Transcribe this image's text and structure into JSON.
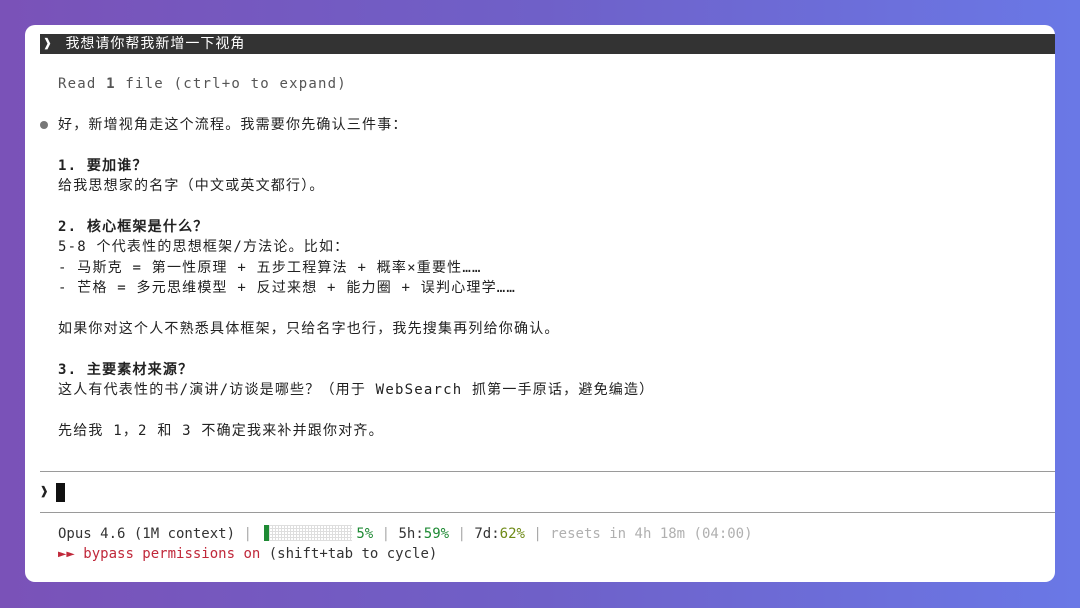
{
  "prompt": {
    "chevron": "❱",
    "text": "我想请你帮我新增一下视角"
  },
  "tool_line": {
    "prefix": "Read ",
    "count": "1",
    "suffix": " file (ctrl+o to expand)"
  },
  "response": {
    "intro": "好，新增视角走这个流程。我需要你先确认三件事：",
    "q1_title": "1. 要加谁？",
    "q1_body": "给我思想家的名字（中文或英文都行）。",
    "q2_title": "2. 核心框架是什么？",
    "q2_body": "5-8 个代表性的思想框架/方法论。比如：",
    "q2_ex1": "- 马斯克 = 第一性原理 + 五步工程算法 + 概率×重要性……",
    "q2_ex2": "- 芒格 = 多元思维模型 + 反过来想 + 能力圈 + 误判心理学……",
    "q2_note": "如果你对这个人不熟悉具体框架，只给名字也行，我先搜集再列给你确认。",
    "q3_title": "3. 主要素材来源？",
    "q3_body": "这人有代表性的书/演讲/访谈是哪些？（用于 WebSearch 抓第一手原话，避免编造）",
    "closing": "先给我 1，2 和 3 不确定我来补并跟你对齐。"
  },
  "input": {
    "chevron": "❱"
  },
  "status": {
    "model": "Opus 4.6 (1M context)",
    "sep": " | ",
    "context_pct": "5%",
    "context_fill": 0.05,
    "five_h_label": "5h:",
    "five_h_value": "59%",
    "seven_d_label": "7d:",
    "seven_d_value": "62%",
    "resets": "resets in 4h 18m (04:00)"
  },
  "permissions": {
    "arrows": "►► ",
    "label": "bypass permissions on",
    "hint": " (shift+tab to cycle)"
  },
  "colors": {
    "accent_green": "#1e8a34",
    "accent_red": "#c0283a",
    "prompt_bg": "#333333"
  }
}
